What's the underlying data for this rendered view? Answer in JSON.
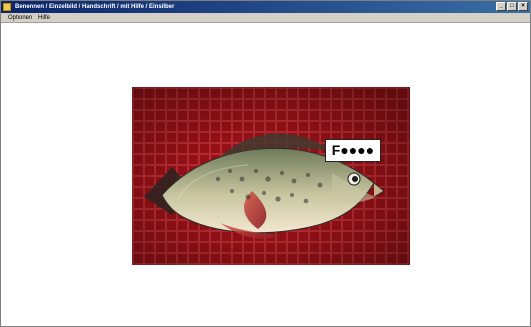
{
  "window": {
    "title": "Benennen / Einzelbild / Handschrift / mit Hilfe / Einsilber",
    "controls": {
      "minimize": "_",
      "maximize": "□",
      "close": "×"
    }
  },
  "menubar": {
    "items": [
      "Optionen",
      "Hilfe"
    ]
  },
  "content": {
    "image": {
      "subject_icon": "fish-photo-icon"
    },
    "answer_label": "F●●●●"
  }
}
